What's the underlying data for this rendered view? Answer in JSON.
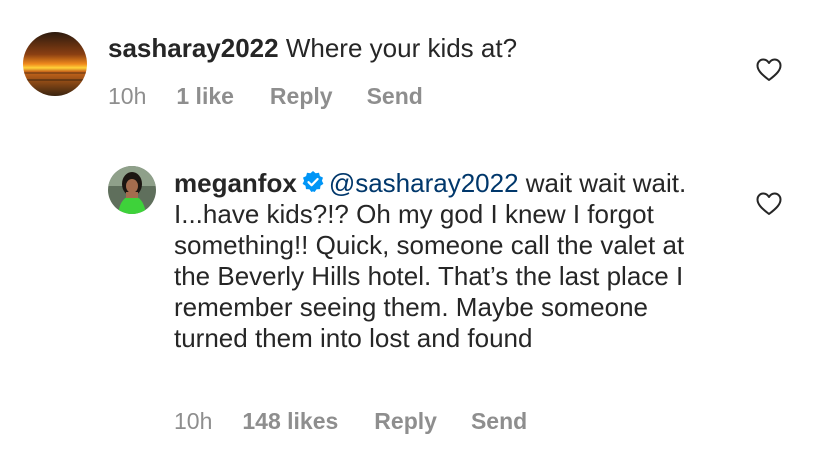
{
  "comments": [
    {
      "username": "sasharay2022",
      "text": "Where your kids at?",
      "time": "10h",
      "likes": "1 like",
      "reply_label": "Reply",
      "send_label": "Send",
      "avatar": "sunset-over-ocean-photo"
    },
    {
      "username": "meganfox",
      "verified": true,
      "mention": "@sasharay2022",
      "text": "wait wait wait. I...have kids?!? Oh my god I knew I forgot something!! Quick, someone call the valet at the Beverly Hills hotel. That’s the last place I remember seeing them. Maybe someone turned them into lost and found",
      "time": "10h",
      "likes": "148 likes",
      "reply_label": "Reply",
      "send_label": "Send",
      "avatar": "person-in-green-outfit-photo"
    }
  ],
  "colors": {
    "text": "#262626",
    "secondary": "#8e8e8e",
    "mention": "#00376b",
    "verified_badge": "#0095f6"
  },
  "icons": {
    "like": "heart-outline-icon",
    "verified": "verified-badge-icon"
  }
}
